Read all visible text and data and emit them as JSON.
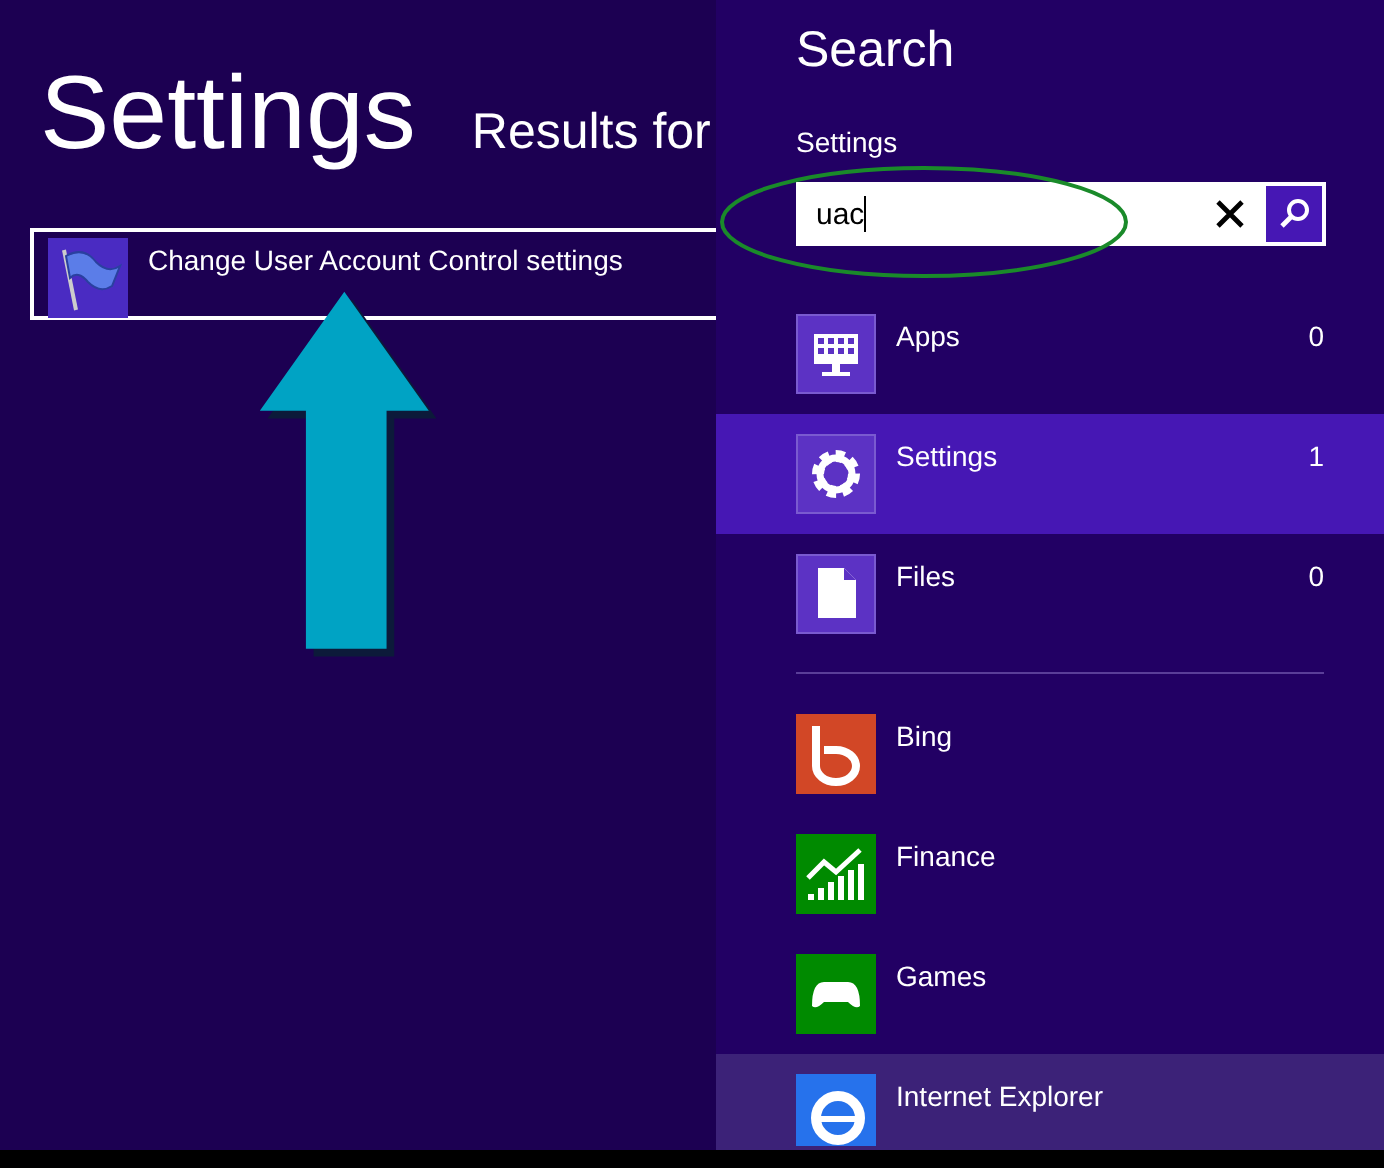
{
  "results_pane": {
    "title": "Settings",
    "subtitle": "Results for",
    "results": [
      {
        "label": "Change User Account Control settings",
        "selected": true
      }
    ]
  },
  "search_pane": {
    "title": "Search",
    "scope": "Settings",
    "search_field": {
      "value": "uac"
    },
    "categories": [
      {
        "label": "Apps",
        "count": "0",
        "selected": false
      },
      {
        "label": "Settings",
        "count": "1",
        "selected": true
      },
      {
        "label": "Files",
        "count": "0",
        "selected": false
      }
    ],
    "apps": [
      {
        "label": "Bing",
        "color": "#d24726",
        "highlighted": false
      },
      {
        "label": "Finance",
        "color": "#008a00",
        "highlighted": false
      },
      {
        "label": "Games",
        "color": "#008a00",
        "highlighted": false
      },
      {
        "label": "Internet Explorer",
        "color": "#2672ec",
        "highlighted": true
      }
    ]
  }
}
